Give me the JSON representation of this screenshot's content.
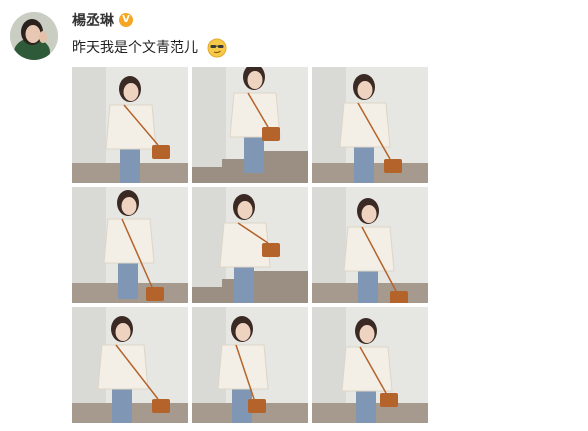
{
  "post": {
    "username": "楊丞琳",
    "verified_badge": "V",
    "text": "昨天我是个文青范儿",
    "emoji": "sunglasses-smug-emoji"
  },
  "photos": [
    {
      "pose": "leaning-smile"
    },
    {
      "pose": "stairs-full-body"
    },
    {
      "pose": "hand-in-pocket"
    },
    {
      "pose": "wall-lean-close"
    },
    {
      "pose": "stairs-walking"
    },
    {
      "pose": "smile-upper-body"
    },
    {
      "pose": "looking-down"
    },
    {
      "pose": "head-tilt"
    },
    {
      "pose": "hand-raised"
    }
  ],
  "colors": {
    "shirt": "#f4efe6",
    "bag": "#b4632a",
    "jeans": "#7f96b4",
    "hair": "#3b2a24",
    "wall": "#e6e6e3",
    "verified": "#f5a623"
  }
}
